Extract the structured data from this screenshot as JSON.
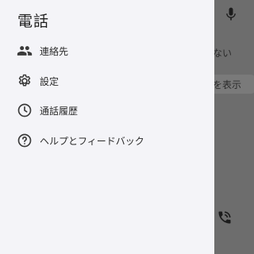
{
  "drawer": {
    "title": "電話",
    "items": [
      {
        "label": "連絡先",
        "icon": "contacts-icon"
      },
      {
        "label": "設定",
        "icon": "gear-icon"
      },
      {
        "label": "通話履歴",
        "icon": "clock-icon"
      },
      {
        "label": "ヘルプとフィードバック",
        "icon": "help-icon"
      }
    ]
  },
  "background": {
    "partial_text_1": "ない",
    "partial_text_2": "を表示",
    "icons": [
      "mic-icon",
      "phone-icon"
    ]
  },
  "colors": {
    "drawer_bg": "#f4f4f8",
    "scrim": "#6d6d6d",
    "text": "#1f1f1f"
  }
}
